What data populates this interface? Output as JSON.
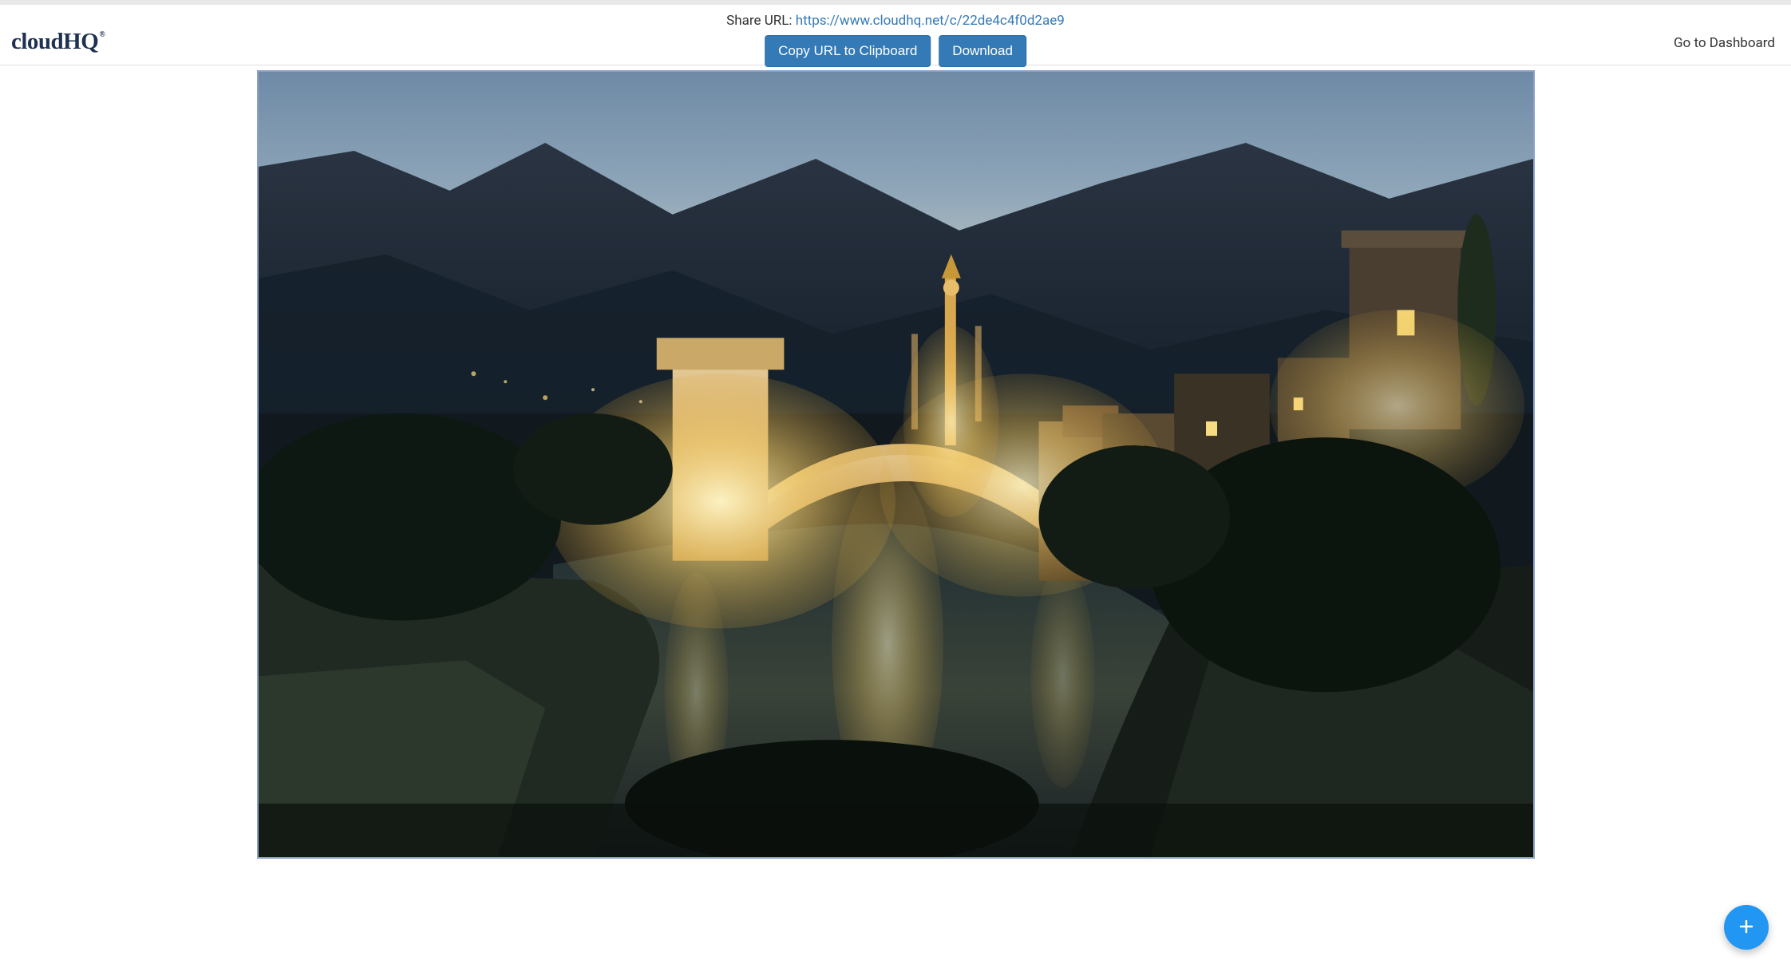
{
  "logo": {
    "text": "cloudHQ",
    "reg": "®"
  },
  "header": {
    "share_label": "Share URL: ",
    "share_url": "https://www.cloudhq.net/c/22de4c4f0d2ae9",
    "copy_btn": "Copy URL to Clipboard",
    "download_btn": "Download",
    "dashboard_link": "Go to Dashboard"
  },
  "fab": {
    "icon": "plus-icon"
  }
}
